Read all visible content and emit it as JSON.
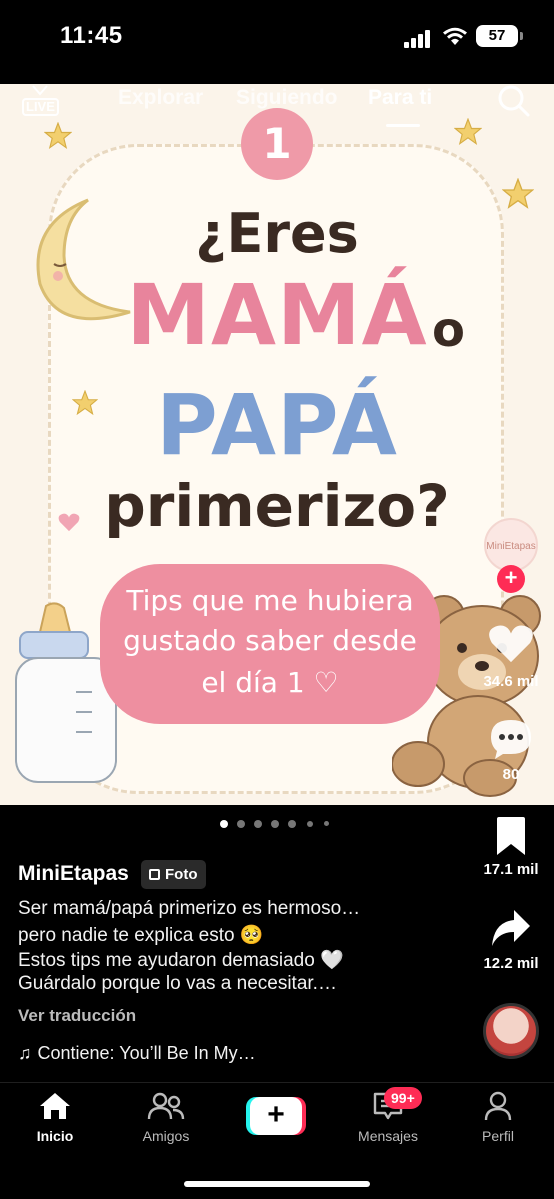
{
  "status_bar": {
    "time": "11:45",
    "battery": "57"
  },
  "top_tabs": {
    "live": "LIVE",
    "tabs": [
      {
        "label": "Explorar",
        "active": false
      },
      {
        "label": "Siguiendo",
        "active": false
      },
      {
        "label": "Para ti",
        "active": true
      }
    ]
  },
  "post_image": {
    "number": "1",
    "line1": "¿Eres",
    "line2": "MAMÁ",
    "line2b": "o",
    "line3": "PAPÁ",
    "line4": "primerizo?",
    "tips": [
      "Tips que me hubiera",
      "gustado saber desde",
      "el día 1 ♡"
    ],
    "account_logo_text": "MiniEtapas",
    "colors": {
      "pink": "#e8849c",
      "blue": "#7d9fd2",
      "dark": "#3a2a22",
      "tips_bg": "#ee8fa0",
      "accent": "#fe2c55"
    }
  },
  "right_rail": {
    "likes": "34.6 mil",
    "comments": "80",
    "saves": "17.1 mil",
    "shares": "12.2 mil"
  },
  "pagination": {
    "count": 7,
    "active_index": 0
  },
  "caption": {
    "username": "MiniEtapas",
    "type_badge": "Foto",
    "lines": [
      "Ser mamá/papá primerizo es hermoso…",
      "pero nadie te explica esto 🥺",
      "Estos tips me ayudaron demasiado 🤍",
      "Guárdalo porque lo vas a necesitar.…"
    ],
    "translate": "Ver traducción",
    "music": "Contiene: You’ll Be In My…"
  },
  "bottom_nav": {
    "items": [
      {
        "label": "Inicio",
        "icon": "home-icon",
        "active": true
      },
      {
        "label": "Amigos",
        "icon": "friends-icon",
        "active": false
      },
      {
        "label": "",
        "icon": "create-icon",
        "active": false
      },
      {
        "label": "Mensajes",
        "icon": "inbox-icon",
        "active": false
      },
      {
        "label": "Perfil",
        "icon": "profile-icon",
        "active": false
      }
    ],
    "messages_badge": "99+"
  }
}
